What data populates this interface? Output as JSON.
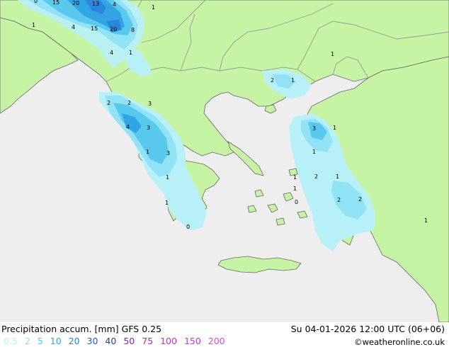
{
  "footer": {
    "title": "Precipitation accum. [mm] GFS 0.25",
    "datetime": "Su 04-01-2026 12:00 UTC (06+06)",
    "credit": "©weatheronline.co.uk",
    "legend": [
      {
        "label": "0.5",
        "color": "#b8f0f8"
      },
      {
        "label": "2",
        "color": "#90e2f4"
      },
      {
        "label": "5",
        "color": "#58c8ec"
      },
      {
        "label": "10",
        "color": "#32a4e4"
      },
      {
        "label": "20",
        "color": "#2a86da"
      },
      {
        "label": "30",
        "color": "#2a5ac4"
      },
      {
        "label": "40",
        "color": "#2a3ea8"
      },
      {
        "label": "50",
        "color": "#7a2aa8"
      },
      {
        "label": "75",
        "color": "#b42ab4"
      },
      {
        "label": "100",
        "color": "#d42ad4"
      },
      {
        "label": "150",
        "color": "#e22ae2"
      },
      {
        "label": "200",
        "color": "#ee3aee"
      }
    ]
  },
  "colors": {
    "sea": "#eeeeee",
    "land": "#c6f3a4",
    "border": "#999999",
    "coast": "#666666"
  },
  "map_labels": [
    "0",
    "15",
    "20",
    "13",
    "4",
    "1",
    "1",
    "4",
    "15",
    "20",
    "8",
    "4",
    "1",
    "2",
    "1",
    "1",
    "2",
    "2",
    "3",
    "3",
    "4",
    "3",
    "1",
    "3",
    "1",
    "1",
    "1",
    "1",
    "1",
    "2",
    "1",
    "0",
    "2",
    "2",
    "1",
    "0",
    "1"
  ]
}
